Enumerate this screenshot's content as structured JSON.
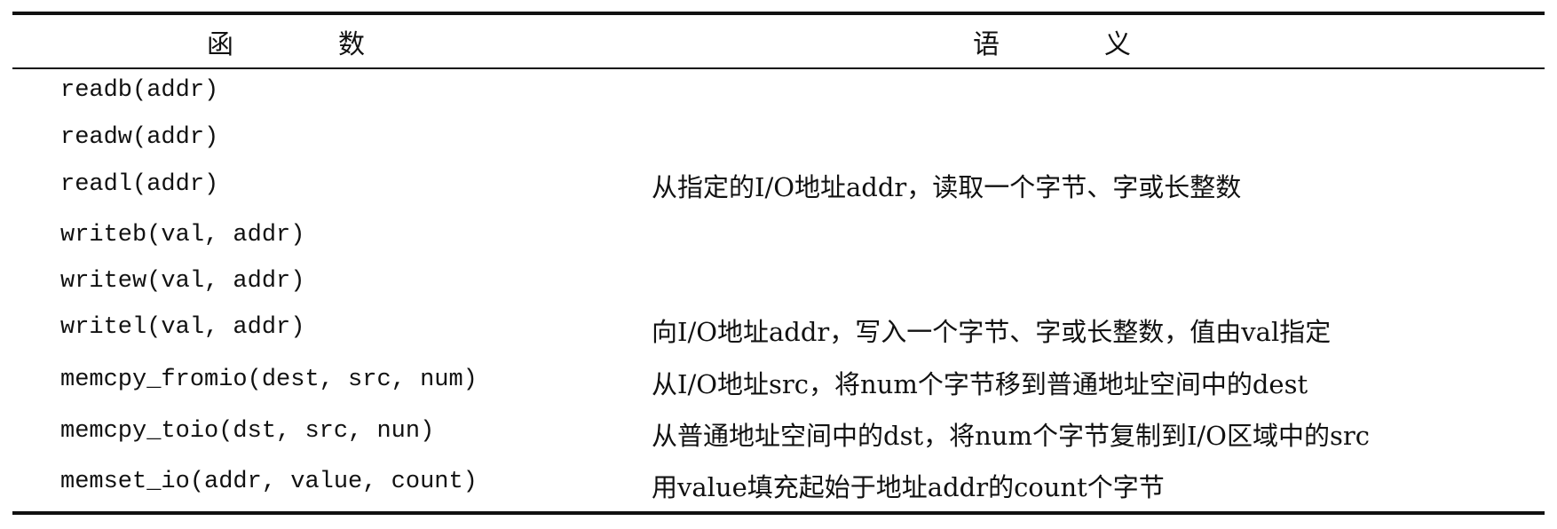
{
  "table": {
    "headers": {
      "function": "函　数",
      "semantics": "语　义"
    },
    "functions": [
      "readb(addr)",
      "readw(addr)",
      "readl(addr)",
      "writeb(val, addr)",
      "writew(val, addr)",
      "writel(val, addr)",
      "memcpy_fromio(dest, src, num)",
      "memcpy_toio(dst, src, nun)",
      "memset_io(addr, value, count)"
    ],
    "semantics": [
      "从指定的I/O地址addr，读取一个字节、字或长整数",
      "向I/O地址addr，写入一个字节、字或长整数，值由val指定",
      "从I/O地址src，将num个字节移到普通地址空间中的dest",
      "从普通地址空间中的dst，将num个字节复制到I/O区域中的src",
      "用value填充起始于地址addr的count个字节"
    ]
  }
}
